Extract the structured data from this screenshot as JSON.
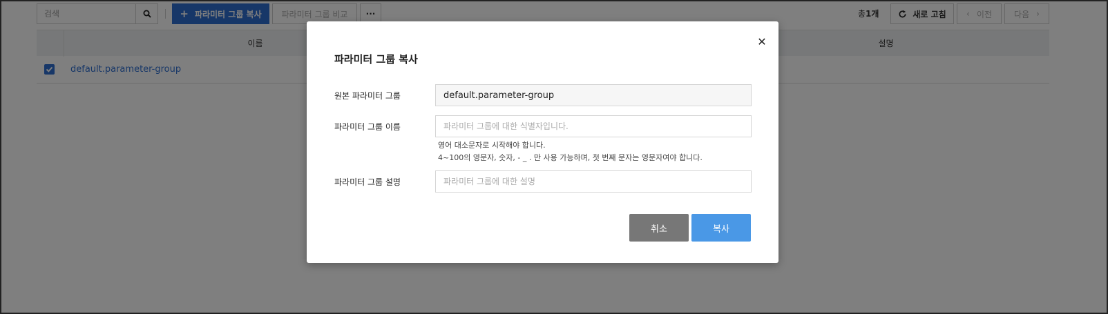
{
  "toolbar": {
    "search_placeholder": "검색",
    "copy_group_label": "파라미터 그룹 복사",
    "compare_group_label": "파라미터 그룹 비교",
    "more_label": "···",
    "total_prefix": "총",
    "total_count": "1개",
    "refresh_label": "새로 고침",
    "prev_label": "이전",
    "next_label": "다음"
  },
  "table": {
    "columns": [
      "이름",
      "설명"
    ],
    "rows": [
      {
        "name": "default.parameter-group",
        "description": "",
        "checked": true
      }
    ]
  },
  "modal": {
    "title": "파라미터 그룹 복사",
    "source_label": "원본 파라미터 그룹",
    "source_value": "default.parameter-group",
    "name_label": "파라미터 그룹 이름",
    "name_placeholder": "파라미터 그룹에 대한 식별자입니다.",
    "hint_line1": "영어 대소문자로 시작해야 합니다.",
    "hint_line2": "4~100의 영문자, 숫자, - _ . 만 사용 가능하며, 첫 번째 문자는 영문자여야 합니다.",
    "desc_label": "파라미터 그룹 설명",
    "desc_placeholder": "파라미터 그룹에 대한 설명",
    "cancel_label": "취소",
    "confirm_label": "복사",
    "close_icon": "close-icon"
  },
  "colors": {
    "primary": "#2f6fd0",
    "confirm": "#4a98e6",
    "cancel": "#777777",
    "overlay": "rgba(0,0,0,0.5)"
  }
}
